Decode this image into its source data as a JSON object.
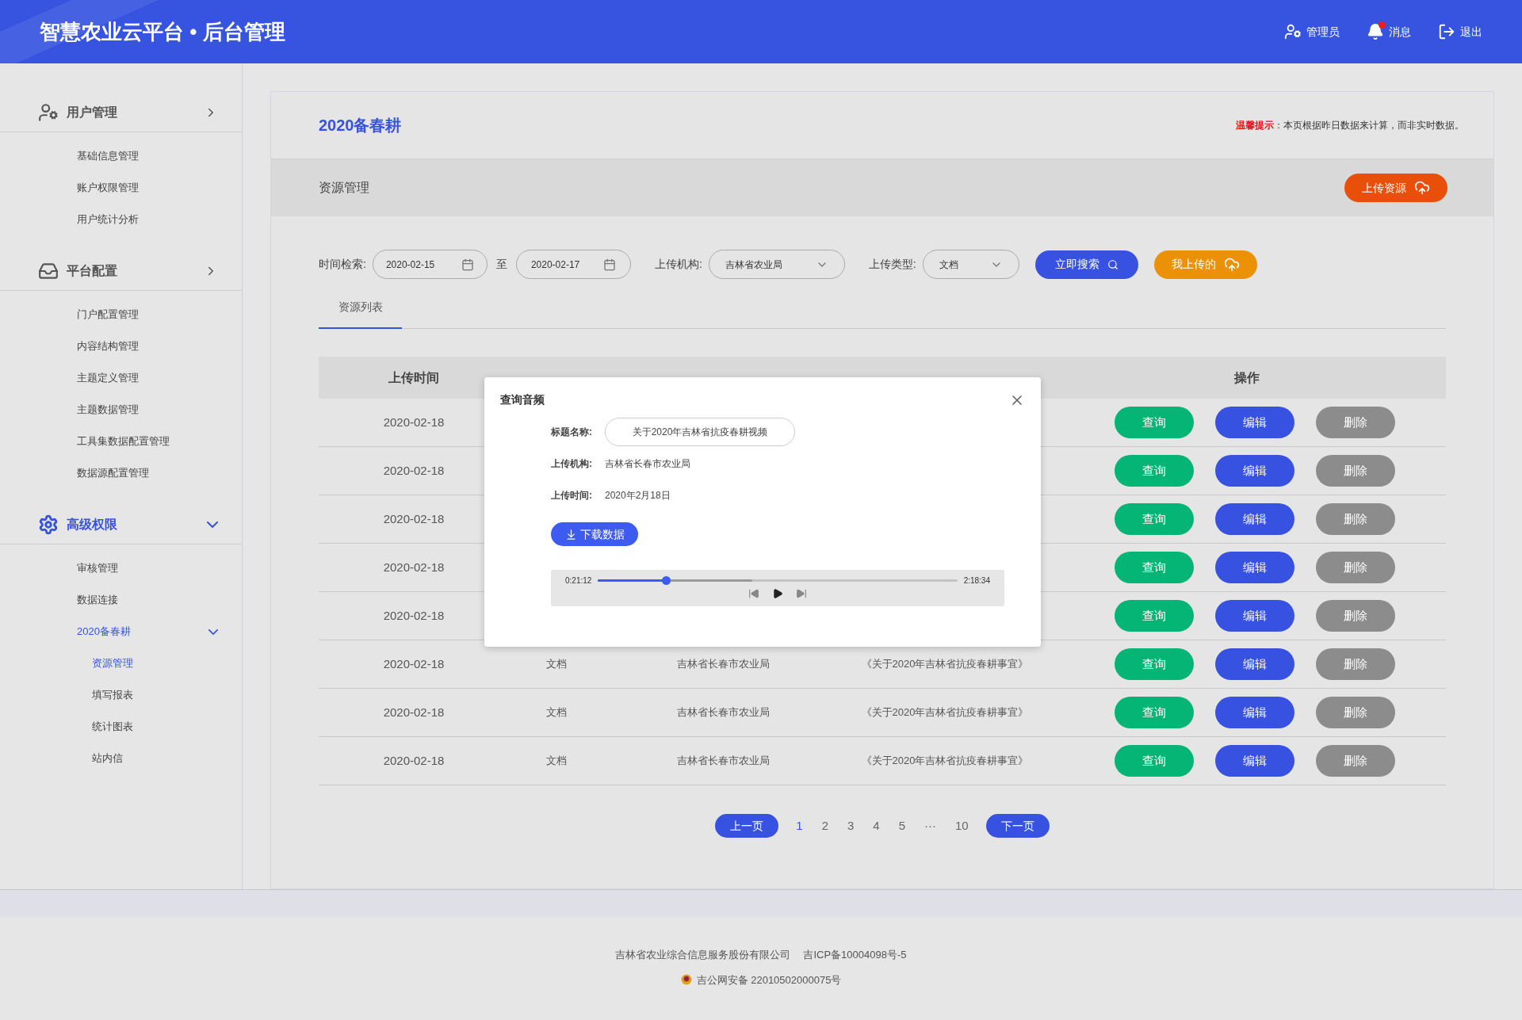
{
  "header": {
    "title": "智慧农业云平台 • 后台管理",
    "actions": [
      {
        "kind": "user",
        "label": "管理员",
        "alert": false
      },
      {
        "kind": "bell",
        "label": "消息",
        "alert": true
      },
      {
        "kind": "logout",
        "label": "退出",
        "alert": false
      }
    ]
  },
  "sidebar": {
    "groups": [
      {
        "kind": "user",
        "label": "用户管理",
        "expanded": false,
        "selected": false,
        "items": [
          {
            "label": "基础信息管理",
            "selected": false
          },
          {
            "label": "账户权限管理",
            "selected": false
          },
          {
            "label": "用户统计分析",
            "selected": false
          }
        ]
      },
      {
        "kind": "inbox",
        "label": "平台配置",
        "expanded": false,
        "selected": false,
        "items": [
          {
            "label": "门户配置管理",
            "selected": false
          },
          {
            "label": "内容结构管理",
            "selected": false
          },
          {
            "label": "主题定义管理",
            "selected": false
          },
          {
            "label": "主题数据管理",
            "selected": false
          },
          {
            "label": "工具集数据配置管理",
            "selected": false
          },
          {
            "label": "数据源配置管理",
            "selected": false
          }
        ]
      },
      {
        "kind": "gears",
        "label": "高级权限",
        "expanded": true,
        "selected": true,
        "items": [
          {
            "label": "审核管理",
            "selected": false
          },
          {
            "label": "数据连接",
            "selected": false
          },
          {
            "label": "2020备春耕",
            "selected": true,
            "expanded": true,
            "children": [
              {
                "label": "资源管理",
                "selected": true
              },
              {
                "label": "填写报表",
                "selected": false
              },
              {
                "label": "统计图表",
                "selected": false
              },
              {
                "label": "站内信",
                "selected": false
              }
            ]
          }
        ]
      }
    ]
  },
  "page": {
    "title": "2020备春耕",
    "notice_label": "温馨提示",
    "notice_text": "：本页根据昨日数据来计算，而非实时数据。",
    "section": "资源管理",
    "upload_button": "上传资源"
  },
  "filters": {
    "time_label": "时间检索:",
    "date_from": "2020-02-15",
    "separator": "至",
    "date_to": "2020-02-17",
    "org_label": "上传机构:",
    "org_value": "吉林省农业局",
    "type_label": "上传类型:",
    "type_value": "文档",
    "search_button": "立即搜索",
    "mine_button": "我上传的"
  },
  "tabs": [
    {
      "label": "资源列表",
      "selected": true
    }
  ],
  "table": {
    "header_time": "上传时间",
    "header_actions": "操作",
    "rows": [
      {
        "time": "2020-02-18",
        "actions": [
          "查询",
          "编辑",
          "删除"
        ]
      },
      {
        "time": "2020-02-18",
        "actions": [
          "查询",
          "编辑",
          "删除"
        ]
      },
      {
        "time": "2020-02-18",
        "actions": [
          "查询",
          "编辑",
          "删除"
        ]
      },
      {
        "time": "2020-02-18",
        "actions": [
          "查询",
          "编辑",
          "删除"
        ]
      },
      {
        "time": "2020-02-18",
        "actions": [
          "查询",
          "编辑",
          "删除"
        ]
      },
      {
        "time": "2020-02-18",
        "type": "文档",
        "org": "吉林省长春市农业局",
        "title": "《关于2020年吉林省抗疫春耕事宜》",
        "actions": [
          "查询",
          "编辑",
          "删除"
        ]
      },
      {
        "time": "2020-02-18",
        "type": "文档",
        "org": "吉林省长春市农业局",
        "title": "《关于2020年吉林省抗疫春耕事宜》",
        "actions": [
          "查询",
          "编辑",
          "删除"
        ]
      },
      {
        "time": "2020-02-18",
        "type": "文档",
        "org": "吉林省长春市农业局",
        "title": "《关于2020年吉林省抗疫春耕事宜》",
        "actions": [
          "查询",
          "编辑",
          "删除"
        ]
      }
    ]
  },
  "pagination": {
    "prev": "上一页",
    "pages": [
      {
        "label": "1",
        "selected": true
      },
      {
        "label": "2",
        "selected": false
      },
      {
        "label": "3",
        "selected": false
      },
      {
        "label": "4",
        "selected": false
      },
      {
        "label": "5",
        "selected": false
      },
      {
        "label": "···",
        "selected": false
      },
      {
        "label": "10",
        "selected": false
      }
    ],
    "next": "下一页"
  },
  "dialog": {
    "title": "查询音频",
    "fields": [
      {
        "kind": "input",
        "label": "标题名称:",
        "value": "关于2020年吉林省抗疫春耕视频"
      },
      {
        "kind": "text",
        "label": "上传机构:",
        "value": "吉林省长春市农业局"
      },
      {
        "kind": "text",
        "label": "上传时间:",
        "value": "2020年2月18日"
      }
    ],
    "download_button": "下载数据",
    "player": {
      "elapsed": "0:21:12",
      "total": "2:18:34",
      "level": 0.19,
      "buffer": {
        "level": 0.43
      }
    }
  },
  "footer": {
    "company": "吉林省农业综合信息服务股份有限公司",
    "icp": "吉ICP备10004098号-5",
    "police": "吉公网安备 22010502000075号"
  }
}
